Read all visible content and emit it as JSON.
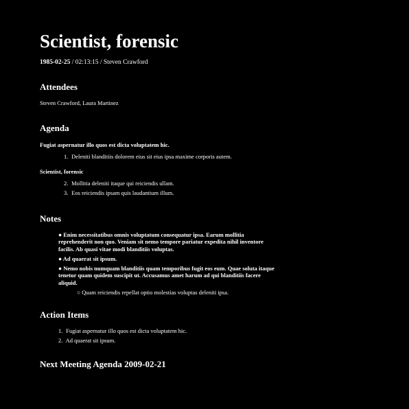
{
  "title": "Scientist, forensic",
  "meta": {
    "date": "1985-02-25",
    "time": "02:13:15",
    "author": "Steven Crawford"
  },
  "attendees": {
    "heading": "Attendees",
    "names": "Steven Crawford, Laura Martinez"
  },
  "agenda": {
    "heading": "Agenda",
    "topics": [
      {
        "title": "Fugiat aspernatur illo quos est dicta voluptatem hic.",
        "items": [
          {
            "num": "1.",
            "text": "Deleniti blanditiis dolorem eius sit eius ipsa maxime corporis autem."
          }
        ]
      },
      {
        "title": "Scientist, forensic",
        "items": [
          {
            "num": "2.",
            "text": "Mollitia deleniti itaque qui reiciendis ullam."
          },
          {
            "num": "3.",
            "text": "Eos reiciendis ipsam quis laudantium illum."
          }
        ]
      }
    ]
  },
  "notes": {
    "heading": "Notes",
    "items": [
      {
        "bullet": "●",
        "text": "Enim necessitatibus omnis voluptatum consequatur ipsa. Earum mollitia reprehenderit non quo. Veniam sit nemo tempore pariatur expedita nihil inventore facilis. Ab quasi vitae modi blanditiis voluptas."
      },
      {
        "bullet": "●",
        "text": "Ad quaerat sit ipsum."
      },
      {
        "bullet": "●",
        "text": "Nemo nobis numquam blanditiis quam temporibus fugit eos eum. Quae soluta itaque tenetur quam quidem suscipit ut. Accusamus amet harum ad qui blanditiis facere aliquid."
      }
    ],
    "subitems": [
      {
        "bullet": "○",
        "text": "Quam reiciendis repellat optio molestias voluptas deleniti ipsa."
      }
    ]
  },
  "action_items": {
    "heading": "Action Items",
    "items": [
      {
        "num": "1.",
        "text": "Fugiat aspernatur illo quos est dicta voluptatem hic."
      },
      {
        "num": "2.",
        "text": "Ad quaerat sit ipsum."
      }
    ]
  },
  "next_meeting": {
    "heading": "Next Meeting Agenda 2009-02-21"
  }
}
